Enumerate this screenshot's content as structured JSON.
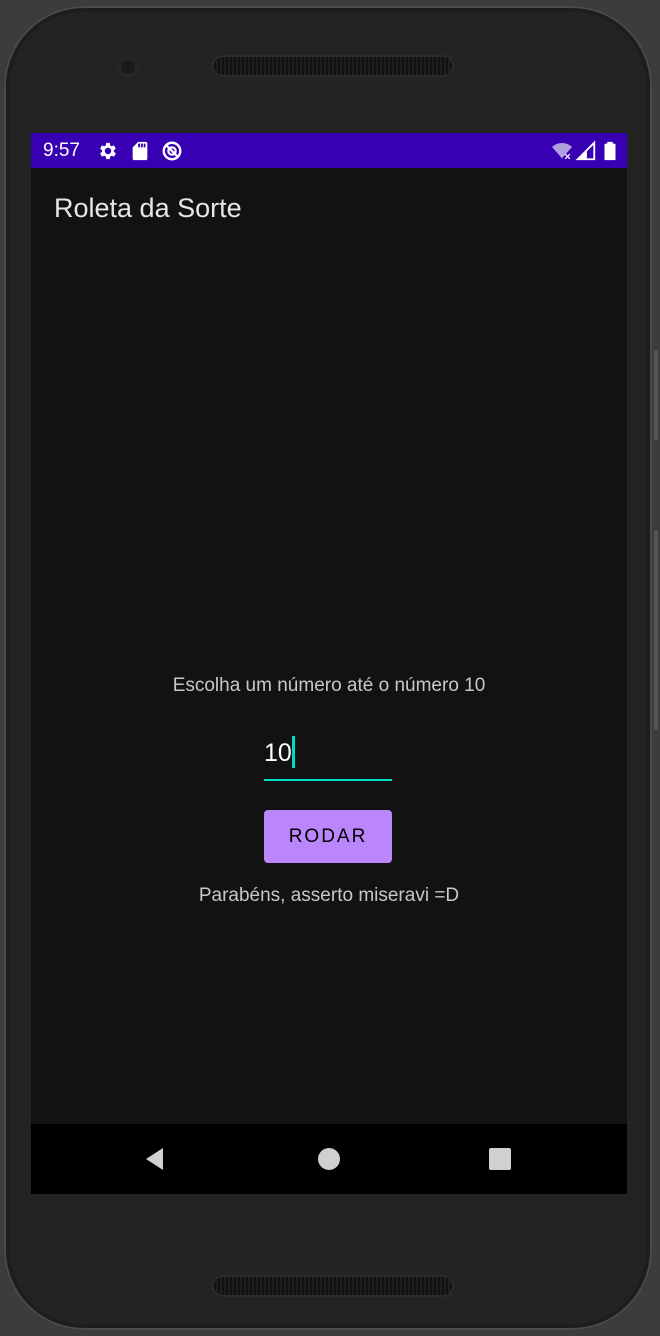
{
  "status_bar": {
    "time": "9:57",
    "icons": [
      "settings-icon",
      "sd-card-icon",
      "no-data-icon",
      "wifi-no-internet-icon",
      "signal-icon",
      "battery-icon"
    ],
    "background": "#3700b3"
  },
  "app_bar": {
    "title": "Roleta da Sorte"
  },
  "main": {
    "prompt": "Escolha um número até o número 10",
    "number_input": {
      "value": "10",
      "accent": "#03dac5"
    },
    "spin_button": {
      "label": "RODAR",
      "color": "#bb86fc"
    },
    "result_message": "Parabéns, asserto miseravi =D"
  },
  "nav_bar": {
    "buttons": [
      "back-icon",
      "home-icon",
      "recents-icon"
    ]
  }
}
